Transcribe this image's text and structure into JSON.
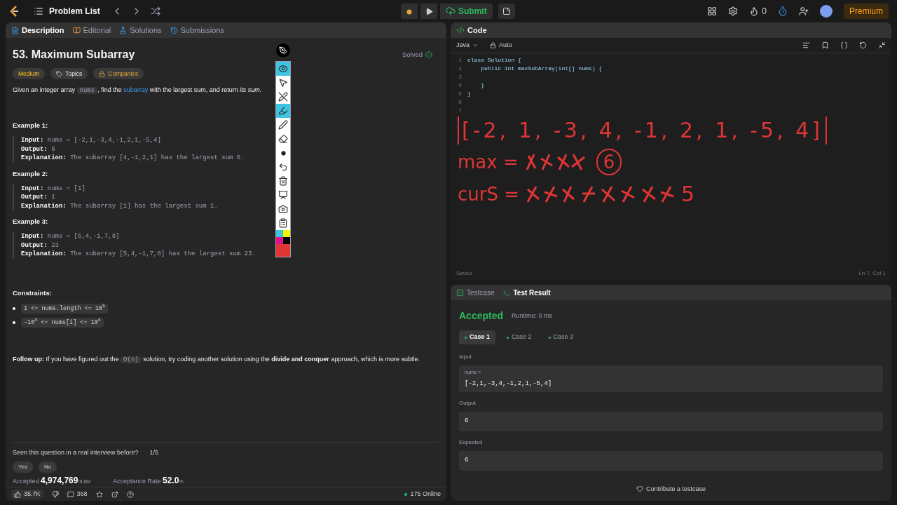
{
  "topbar": {
    "title": "Problem List",
    "submit": "Submit",
    "streak": "0",
    "premium": "Premium"
  },
  "left_tabs": [
    {
      "label": "Description",
      "selected": true
    },
    {
      "label": "Editorial",
      "selected": false
    },
    {
      "label": "Solutions",
      "selected": false
    },
    {
      "label": "Submissions",
      "selected": false
    }
  ],
  "problem": {
    "title": "53. Maximum Subarray",
    "status": "Solved",
    "tags": [
      {
        "label": "Medium",
        "kind": "difficulty"
      },
      {
        "label": "Topics",
        "kind": "tag"
      },
      {
        "label": "Companies",
        "kind": "lock"
      }
    ],
    "statement_before": "Given an integer array",
    "statement_code": "nums",
    "statement_mid": ", find the",
    "statement_link": "subarray",
    "statement_after": "with the largest sum, and return *its sum*.",
    "examples": [
      {
        "heading": "Example 1:",
        "lines": [
          {
            "label": "Input:",
            "value": "nums = [-2,1,-3,4,-1,2,1,-5,4]"
          },
          {
            "label": "Output:",
            "value": "6"
          },
          {
            "label": "Explanation:",
            "value": "The subarray [4,-1,2,1] has the largest sum 6."
          }
        ]
      },
      {
        "heading": "Example 2:",
        "lines": [
          {
            "label": "Input:",
            "value": "nums = [1]"
          },
          {
            "label": "Output:",
            "value": "1"
          },
          {
            "label": "Explanation:",
            "value": "The subarray [1] has the largest sum 1."
          }
        ]
      },
      {
        "heading": "Example 3:",
        "lines": [
          {
            "label": "Input:",
            "value": "nums = [5,4,-1,7,8]"
          },
          {
            "label": "Output:",
            "value": "23"
          },
          {
            "label": "Explanation:",
            "value": "The subarray [5,4,-1,7,8] has the largest sum 23."
          }
        ]
      }
    ],
    "constraints_heading": "Constraints:",
    "constraints": [
      "1 <= nums.length <= 10$^{5}$",
      "-10$^{4}$ <= nums[i] <= 10$^{4}$"
    ],
    "followup_label": "Follow up:",
    "followup_before": "If you have figured out the",
    "followup_code": "O(n)",
    "followup_after": "solution, try coding another solution using the **divide and conquer** approach, which is more subtle.",
    "interview_question": "Seen this question in a real interview before?",
    "interview_count": "1/5",
    "answers": [
      "Yes",
      "No"
    ],
    "accepted_label": "Accepted",
    "accepted_value": "4,974,769",
    "accepted_total": "/9.6M",
    "rate_label": "Acceptance Rate",
    "rate_value": "52.0",
    "rate_unit": "%"
  },
  "footer": {
    "likes": "35.7K",
    "comments": "368",
    "online": "175 Online"
  },
  "annotation_tools": [
    {
      "kind": "eye",
      "selected": true
    },
    {
      "kind": "pointer",
      "selected": false
    },
    {
      "kind": "no-pen",
      "selected": false
    },
    {
      "kind": "highlighter",
      "selected": true
    },
    {
      "kind": "pen",
      "selected": false
    },
    {
      "kind": "eraser",
      "selected": false
    },
    {
      "kind": "dot",
      "selected": false
    },
    {
      "kind": "undo",
      "selected": false
    },
    {
      "kind": "trash",
      "selected": false
    },
    {
      "kind": "board",
      "selected": false
    },
    {
      "kind": "camera",
      "selected": false
    },
    {
      "kind": "clipboard",
      "selected": false
    }
  ],
  "palette": [
    {
      "color": "#3ec3e0"
    },
    {
      "color": "#f5f500"
    },
    {
      "color": "#e0108a"
    },
    {
      "color": "#000000"
    },
    {
      "color": "#e03535"
    }
  ],
  "code": {
    "title": "Code",
    "language": "Java",
    "mode": "Auto",
    "lines": [
      {
        "number": "1",
        "text": "class Solution {"
      },
      {
        "number": "2",
        "text": "    public int maxSubArray(int[] nums) {"
      },
      {
        "number": "3"
      },
      {
        "number": "4",
        "text": "    }"
      },
      {
        "number": "5",
        "text": "}"
      },
      {
        "number": "6"
      },
      {
        "number": "7"
      }
    ],
    "status": "Saved",
    "position": "Ln 7, Col 1"
  },
  "annotations": {
    "array": "[-2, 1, -3, 4, -1, 2, 1, -5, 4]",
    "max_label": "max =",
    "max_value": "6",
    "cur_label": "curS =",
    "cur_value": "5"
  },
  "result_tabs": [
    {
      "label": "Testcase",
      "selected": false
    },
    {
      "label": "Test Result",
      "selected": true
    }
  ],
  "result": {
    "verdict": "Accepted",
    "runtime": "Runtime: 0 ms",
    "cases": [
      {
        "label": "Case 1",
        "selected": true
      },
      {
        "label": "Case 2",
        "selected": false
      },
      {
        "label": "Case 3",
        "selected": false
      }
    ],
    "input_label": "Input",
    "input_name": "nums =",
    "input_value": "[-2,1,-3,4,-1,2,1,-5,4]",
    "output_label": "Output",
    "output_value": "6",
    "expected_label": "Expected",
    "expected_value": "6",
    "contribute": "Contribute a testcase"
  }
}
